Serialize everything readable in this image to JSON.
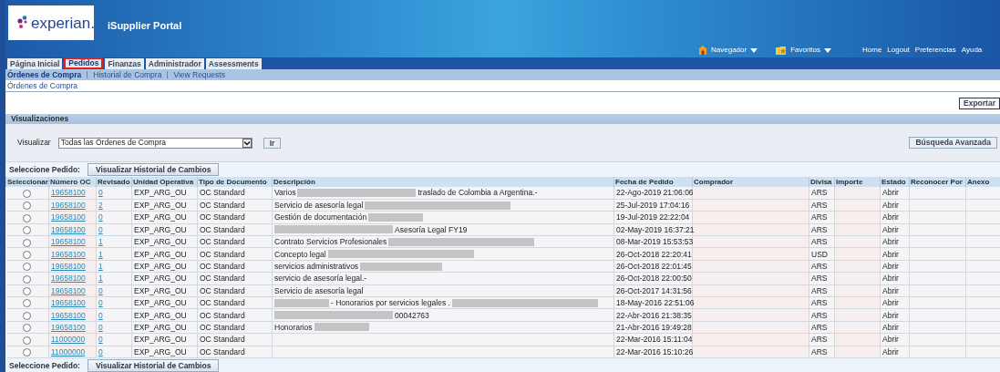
{
  "header": {
    "logo_text": "experian.",
    "title": "iSupplier Portal",
    "menus": [
      {
        "label": "Navegador",
        "kind": "home"
      },
      {
        "label": "Favoritos",
        "kind": "favorites"
      }
    ],
    "links": [
      "Home",
      "Logout",
      "Preferencias",
      "Ayuda"
    ]
  },
  "tabs": [
    {
      "label": "Página Inicial",
      "selected": false
    },
    {
      "label": "Pedidos",
      "selected": true
    },
    {
      "label": "Finanzas",
      "selected": false
    },
    {
      "label": "Administrador",
      "selected": false
    },
    {
      "label": "Assessments",
      "selected": false
    }
  ],
  "subtabs": [
    {
      "label": "Órdenes de Compra",
      "selected": true
    },
    {
      "label": "Historial de Compra",
      "selected": false
    },
    {
      "label": "View Requests",
      "selected": false
    }
  ],
  "page_title": "Órdenes de Compra",
  "export_button": "Exportar",
  "views": {
    "title": "Visualizaciones",
    "label": "Visualizar",
    "value": "Todas las Órdenes de Compra",
    "go_button": "Ir",
    "advanced_button": "Búsqueda Avanzada"
  },
  "select_bar": {
    "label": "Seleccione Pedido:",
    "button": "Visualizar Historial de Cambios"
  },
  "table": {
    "columns": [
      "Seleccionar",
      "Número OC",
      "Revisado",
      "Unidad Operativa",
      "Tipo de Documento",
      "Descripción",
      "Fecha de Pedido",
      "Comprador",
      "Divisa",
      "Importe",
      "Estado",
      "Reconocer Por",
      "Anexo"
    ],
    "rows": [
      {
        "selected": false,
        "po": "19658100",
        "rev": "0",
        "unit": "EXP_ARG_OU",
        "type": "OC Standard",
        "desc": [
          {
            "kind": "text",
            "text": "Varios"
          },
          {
            "kind": "long"
          },
          {
            "kind": "text",
            "text": "traslado de Colombia a Argentina.-"
          }
        ],
        "date": "22-Ago-2019 21:06:06",
        "currency": "ARS",
        "status": "Abrir"
      },
      {
        "selected": false,
        "po": "19658100",
        "rev": "2",
        "unit": "EXP_ARG_OU",
        "type": "OC Standard",
        "desc": [
          {
            "kind": "text",
            "text": "Servicio de asesoría legal"
          },
          {
            "kind": "wide"
          }
        ],
        "date": "25-Jul-2019 17:04:16",
        "currency": "ARS",
        "status": "Abrir"
      },
      {
        "selected": false,
        "po": "19658100",
        "rev": "0",
        "unit": "EXP_ARG_OU",
        "type": "OC Standard",
        "desc": [
          {
            "kind": "text",
            "text": "Gestión de documentación"
          },
          {
            "kind": "short"
          }
        ],
        "date": "19-Jul-2019 22:22:04",
        "currency": "ARS",
        "status": "Abrir"
      },
      {
        "selected": false,
        "po": "19658100",
        "rev": "0",
        "unit": "EXP_ARG_OU",
        "type": "OC Standard",
        "desc": [
          {
            "kind": "long"
          },
          {
            "kind": "text",
            "text": "Asesoría Legal FY19"
          }
        ],
        "date": "02-May-2019 16:37:21",
        "currency": "ARS",
        "status": "Abrir"
      },
      {
        "selected": false,
        "po": "19658100",
        "rev": "1",
        "unit": "EXP_ARG_OU",
        "type": "OC Standard",
        "desc": [
          {
            "kind": "text",
            "text": "Contrato Servicios Profesionales"
          },
          {
            "kind": "wide"
          }
        ],
        "date": "08-Mar-2019 15:53:53",
        "currency": "ARS",
        "status": "Abrir"
      },
      {
        "selected": false,
        "po": "19658100",
        "rev": "1",
        "unit": "EXP_ARG_OU",
        "type": "OC Standard",
        "desc": [
          {
            "kind": "text",
            "text": "Concepto legal"
          },
          {
            "kind": "wide"
          }
        ],
        "date": "26-Oct-2018 22:20:41",
        "currency": "USD",
        "status": "Abrir"
      },
      {
        "selected": false,
        "po": "19658100",
        "rev": "1",
        "unit": "EXP_ARG_OU",
        "type": "OC Standard",
        "desc": [
          {
            "kind": "text",
            "text": "servicios administrativos"
          },
          {
            "kind": "medium"
          }
        ],
        "date": "26-Oct-2018 22:01:45",
        "currency": "ARS",
        "status": "Abrir"
      },
      {
        "selected": false,
        "po": "19658100",
        "rev": "1",
        "unit": "EXP_ARG_OU",
        "type": "OC Standard",
        "desc": [
          {
            "kind": "text",
            "text": "servicio de asesoría legal.-"
          }
        ],
        "date": "26-Oct-2018 22:00:50",
        "currency": "ARS",
        "status": "Abrir"
      },
      {
        "selected": false,
        "po": "19658100",
        "rev": "0",
        "unit": "EXP_ARG_OU",
        "type": "OC Standard",
        "desc": [
          {
            "kind": "text",
            "text": "Servicio de asesoría legal"
          }
        ],
        "date": "26-Oct-2017 14:31:56",
        "currency": "ARS",
        "status": "Abrir"
      },
      {
        "selected": false,
        "po": "19658100",
        "rev": "0",
        "unit": "EXP_ARG_OU",
        "type": "OC Standard",
        "desc": [
          {
            "kind": "short"
          },
          {
            "kind": "text",
            "text": "- Honorarios por servicios legales ."
          },
          {
            "kind": "wide"
          }
        ],
        "date": "18-May-2016 22:51:06",
        "currency": "ARS",
        "status": "Abrir"
      },
      {
        "selected": false,
        "po": "19658100",
        "rev": "0",
        "unit": "EXP_ARG_OU",
        "type": "OC Standard",
        "desc": [
          {
            "kind": "long"
          },
          {
            "kind": "text",
            "text": "00042763"
          }
        ],
        "date": "22-Abr-2016 21:38:35",
        "currency": "ARS",
        "status": "Abrir"
      },
      {
        "selected": false,
        "po": "19658100",
        "rev": "0",
        "unit": "EXP_ARG_OU",
        "type": "OC Standard",
        "desc": [
          {
            "kind": "text",
            "text": "Honorarios"
          },
          {
            "kind": "short"
          }
        ],
        "date": "21-Abr-2016 19:49:28",
        "currency": "ARS",
        "status": "Abrir"
      },
      {
        "selected": false,
        "po": "11000000",
        "rev": "0",
        "unit": "EXP_ARG_OU",
        "type": "OC Standard",
        "desc": [],
        "date": "22-Mar-2016 15:11:04",
        "currency": "ARS",
        "status": "Abrir"
      },
      {
        "selected": false,
        "po": "11000000",
        "rev": "0",
        "unit": "EXP_ARG_OU",
        "type": "OC Standard",
        "desc": [],
        "date": "22-Mar-2016 15:10:26",
        "currency": "ARS",
        "status": "Abrir"
      }
    ]
  },
  "bottom_bar": {
    "label": "Seleccione Pedido:",
    "button": "Visualizar Historial de Cambios"
  }
}
